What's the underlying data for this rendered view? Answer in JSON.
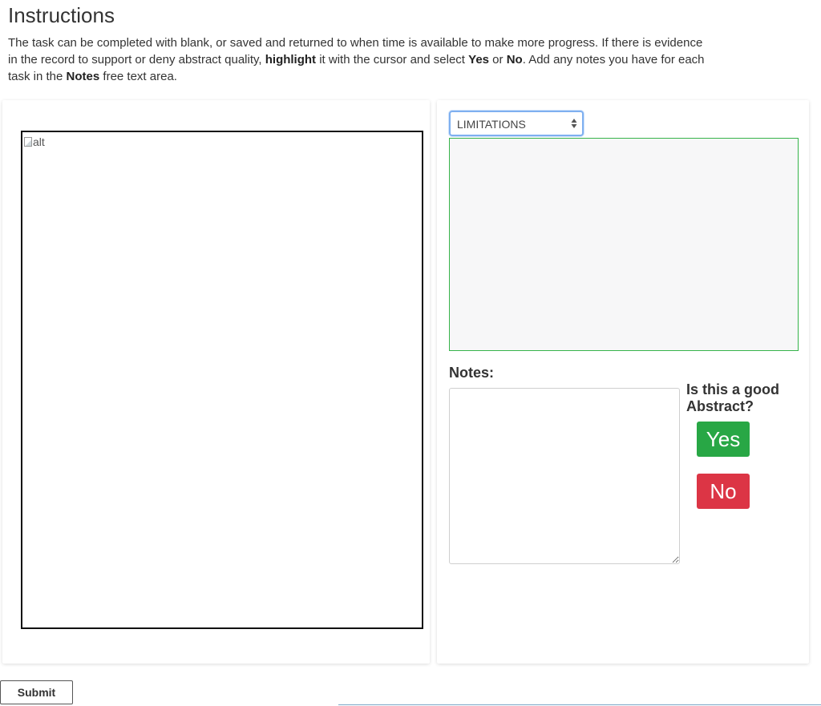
{
  "page": {
    "title": "Instructions",
    "instructions": {
      "part1": "The task can be completed with blank, or saved and returned to when time is available to make more progress. If there is evidence in the record to support or deny abstract quality, ",
      "highlight": "highlight",
      "part2": " it with the cursor and select ",
      "yes": "Yes",
      "part3": " or ",
      "no": "No",
      "part4": ". Add any notes you have for each task in the ",
      "notes": "Notes",
      "part5": " free text area."
    }
  },
  "left_panel": {
    "image_alt": "alt",
    "image_icon": "broken-image-icon"
  },
  "right_panel": {
    "category_select": {
      "selected": "LIMITATIONS",
      "icon": "select-arrows-icon"
    },
    "notes_label": "Notes:",
    "notes_value": "",
    "question": "Is this a good Abstract?",
    "yes_label": "Yes",
    "no_label": "No",
    "colors": {
      "yes": "#28a745",
      "no": "#dc3545",
      "highlight_border": "#36b34a",
      "select_focus": "#7fb0f0"
    }
  },
  "footer": {
    "submit_label": "Submit"
  }
}
